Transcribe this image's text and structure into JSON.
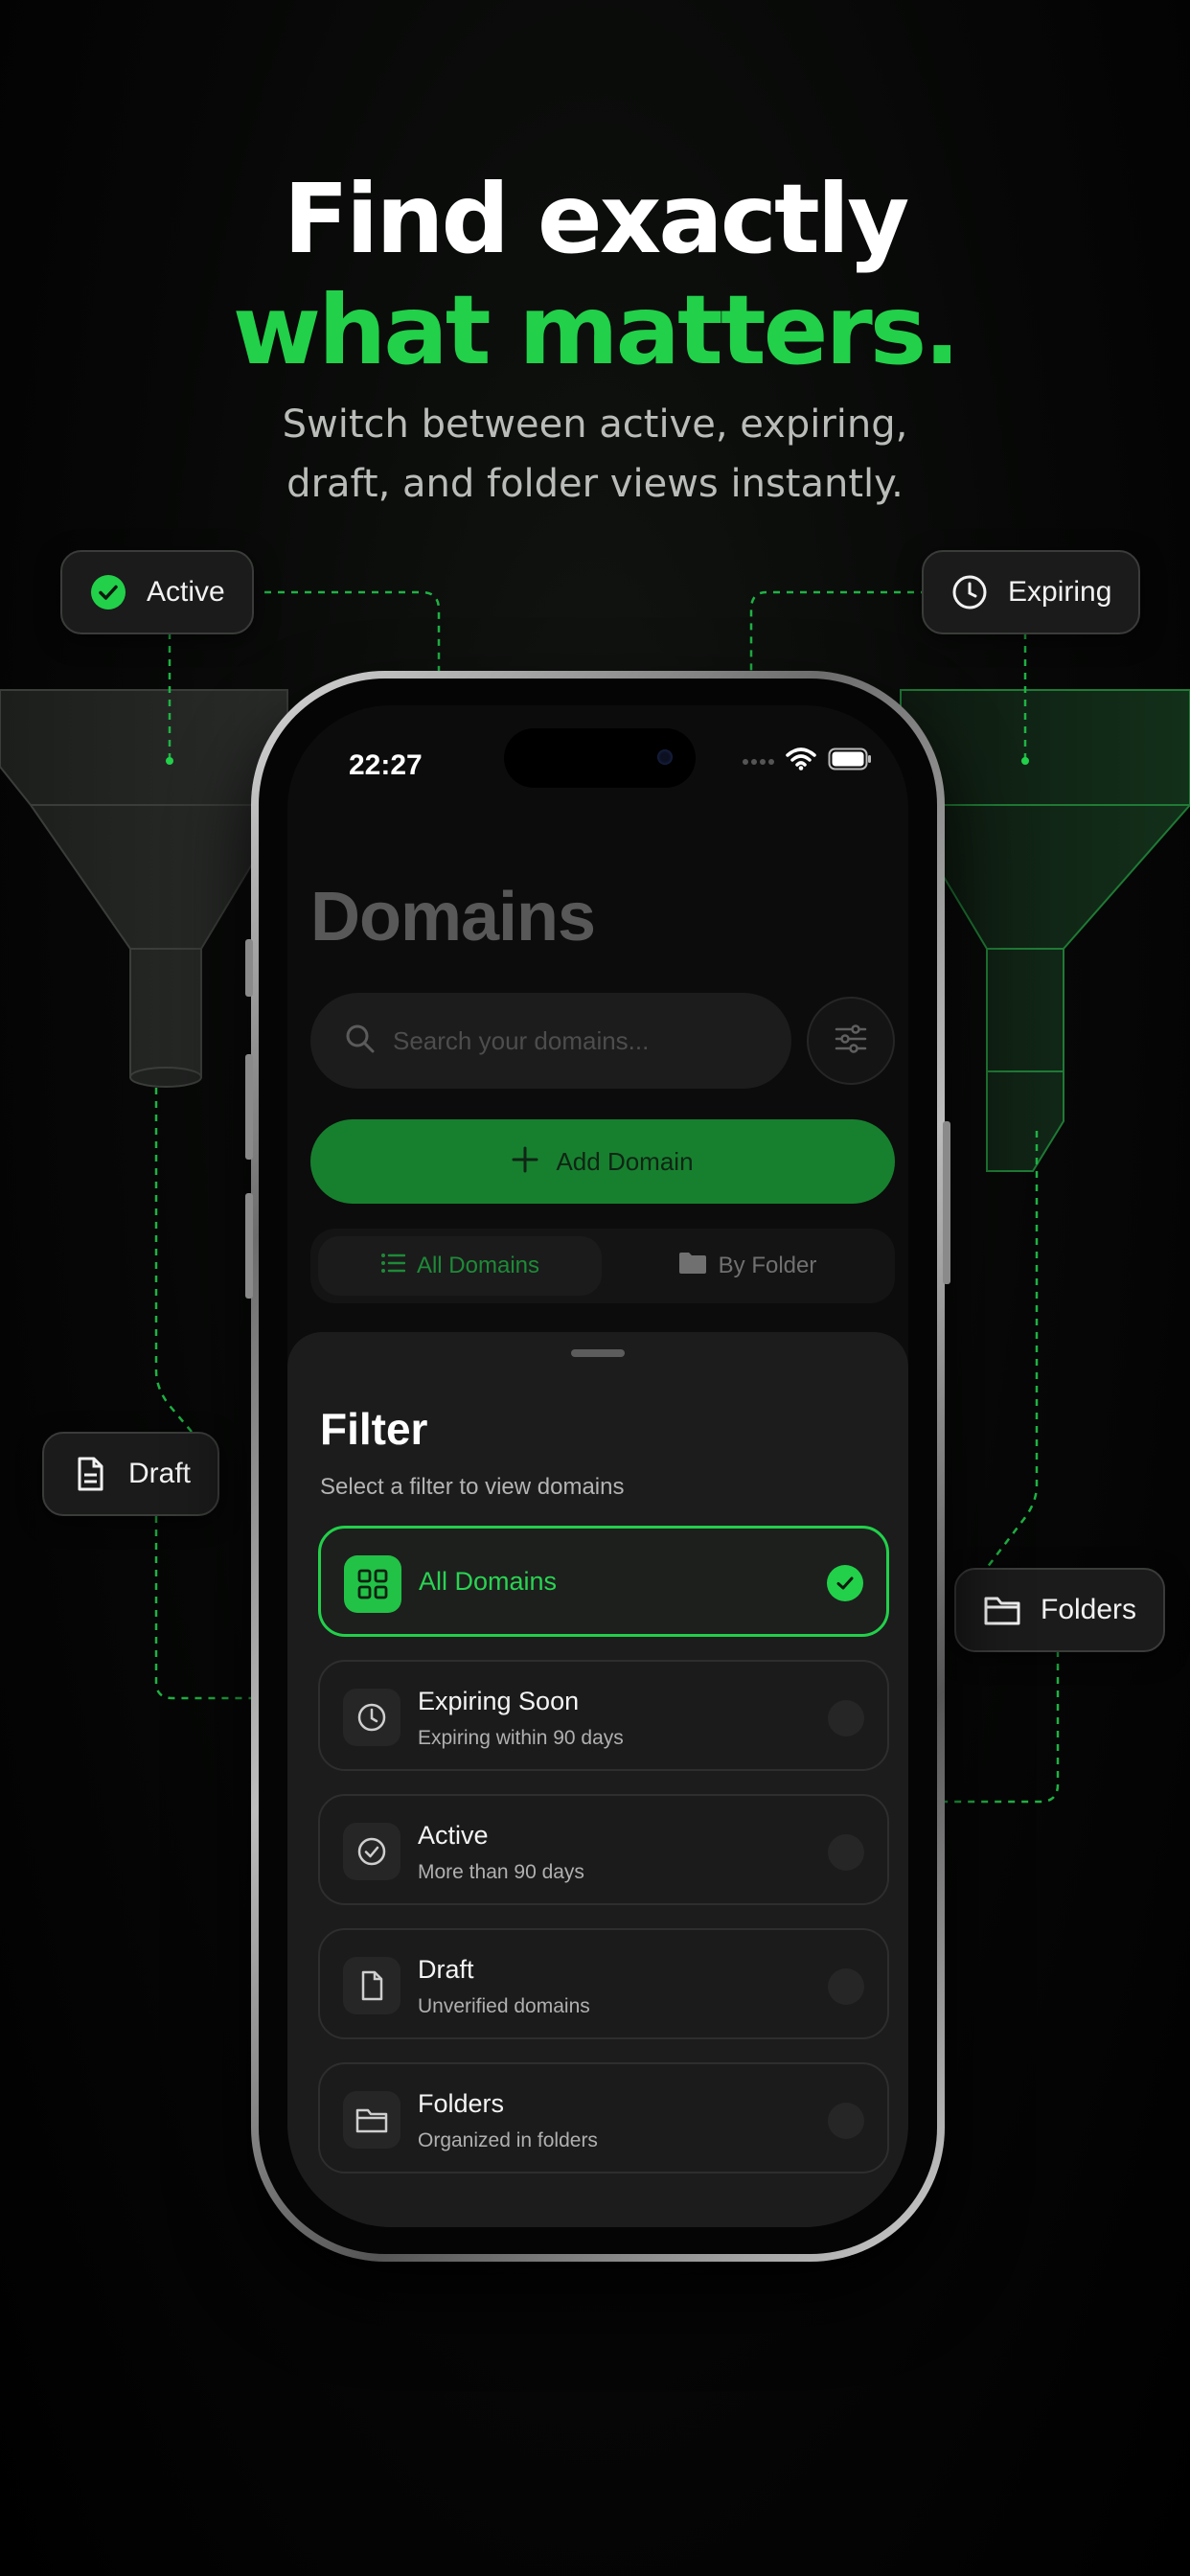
{
  "hero": {
    "line1": "Find exactly",
    "line2": "what matters.",
    "sub1": "Switch between active, expiring,",
    "sub2": "draft, and folder views instantly."
  },
  "chips": {
    "active": "Active",
    "expiring": "Expiring",
    "draft": "Draft",
    "folders": "Folders"
  },
  "status_bar": {
    "time": "22:27"
  },
  "screen": {
    "title": "Domains",
    "search_placeholder": "Search your domains...",
    "add_button": "Add Domain",
    "segments": {
      "all": "All Domains",
      "folder": "By Folder"
    }
  },
  "sheet": {
    "title": "Filter",
    "subtitle": "Select a filter to view domains",
    "options": [
      {
        "label": "All Domains",
        "desc": "",
        "icon": "grid-icon",
        "selected": true
      },
      {
        "label": "Expiring Soon",
        "desc": "Expiring within 90 days",
        "icon": "clock-icon",
        "selected": false
      },
      {
        "label": "Active",
        "desc": "More than 90 days",
        "icon": "check-circle-icon",
        "selected": false
      },
      {
        "label": "Draft",
        "desc": "Unverified domains",
        "icon": "document-icon",
        "selected": false
      },
      {
        "label": "Folders",
        "desc": "Organized in folders",
        "icon": "folder-icon",
        "selected": false
      }
    ]
  },
  "colors": {
    "accent": "#22d04a",
    "background": "#000000",
    "card": "#1c1c1c"
  }
}
